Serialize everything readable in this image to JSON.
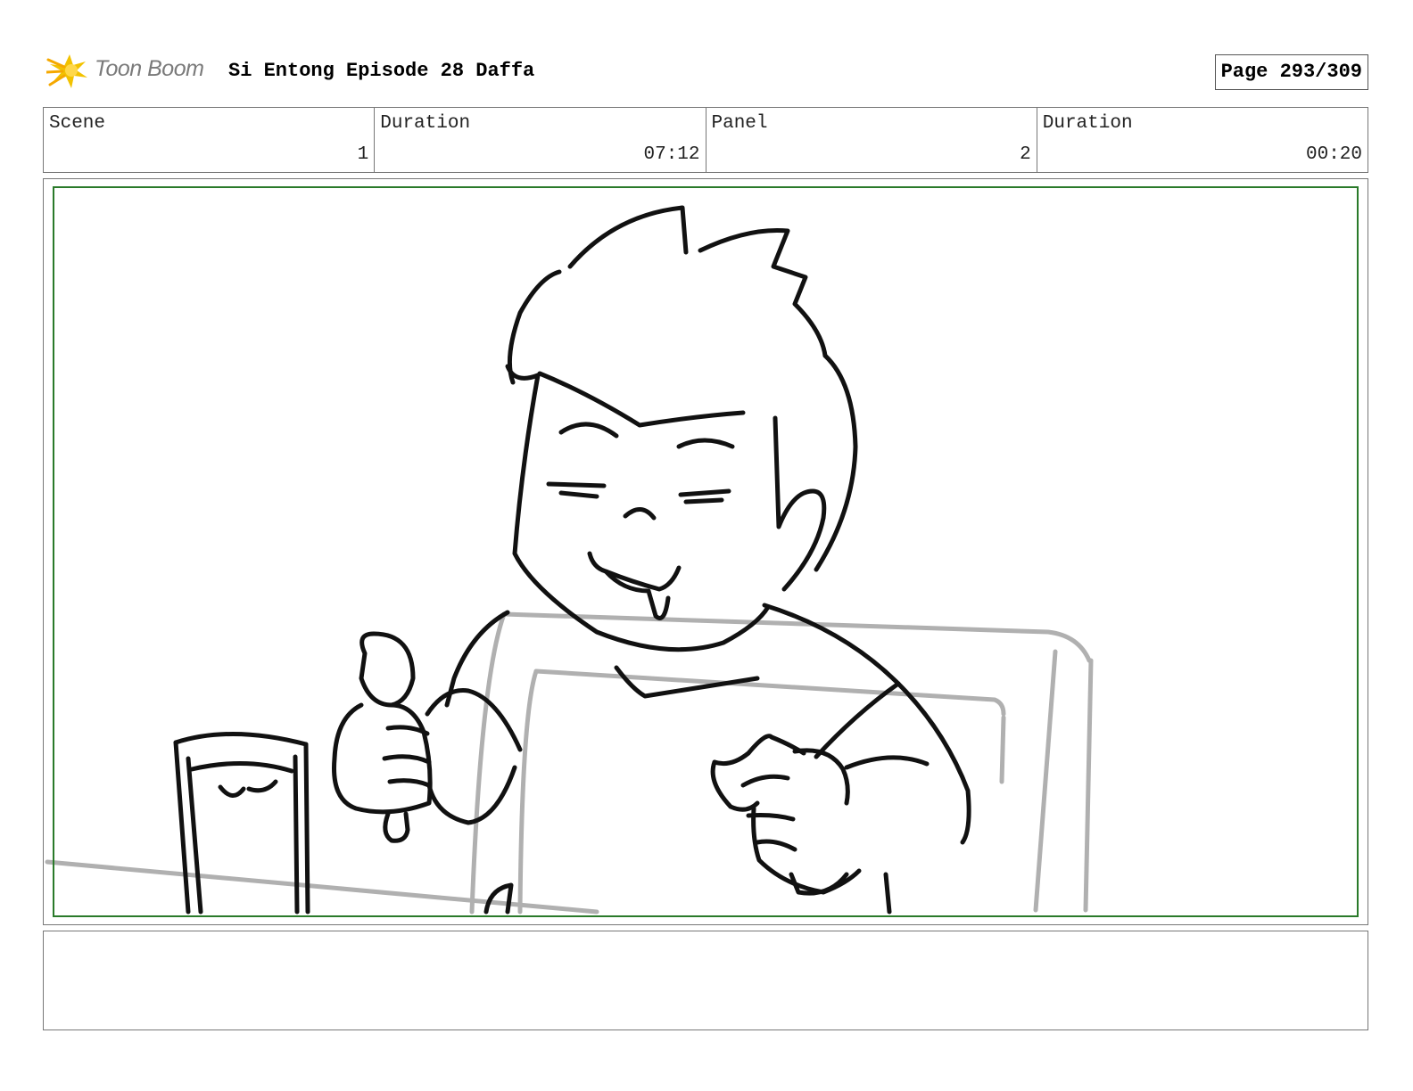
{
  "header": {
    "logo_text": "Toon Boom",
    "title": "Si Entong Episode 28 Daffa",
    "page": "Page 293/309"
  },
  "info": {
    "scene_label": "Scene",
    "scene_value": "1",
    "scene_duration_label": "Duration",
    "scene_duration_value": "07:12",
    "panel_label": "Panel",
    "panel_value": "2",
    "panel_duration_label": "Duration",
    "panel_duration_value": "00:20"
  },
  "notes": {
    "text": ""
  },
  "colors": {
    "safe_frame": "#2a7a2a",
    "sketch_line": "#111111",
    "layout_line": "#b0b0b0",
    "logo_star": "#f2c200"
  },
  "icons": {
    "logo": "toon-boom-star-icon"
  }
}
